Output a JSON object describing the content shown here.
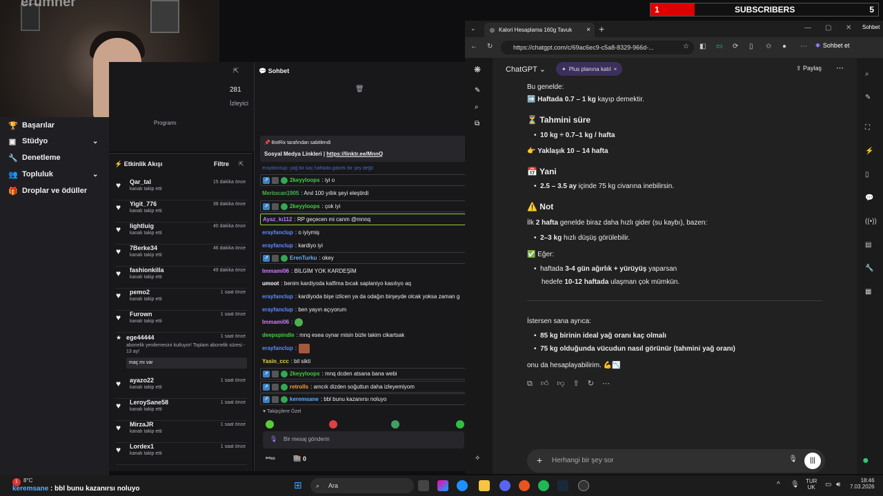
{
  "overlay": {
    "goal_current": "1",
    "label": "SUBSCRIBERS",
    "goal_target": "5",
    "watermark": "erumher"
  },
  "twitch": {
    "stream_viewers": "281",
    "stream_viewers_label": "İzleyici",
    "programs_label": "Programı",
    "nav": [
      {
        "label": "Başarılar",
        "icon": "trophy-icon"
      },
      {
        "label": "Stüdyo",
        "icon": "studio-icon"
      },
      {
        "label": "Denetleme",
        "icon": "wrench-icon"
      },
      {
        "label": "Topluluk",
        "icon": "people-icon"
      },
      {
        "label": "Droplar ve ödüller",
        "icon": "gift-icon"
      }
    ],
    "activity": {
      "title": "Etkinlik Akışı",
      "filter": "Filtre",
      "items": [
        {
          "name": "Qar_tal",
          "sub": "kanalı takip etti",
          "time": "15 dakika önce"
        },
        {
          "name": "Yigit_776",
          "sub": "kanalı takip etti",
          "time": "38 dakika önce"
        },
        {
          "name": "lightluig",
          "sub": "kanalı takip etti",
          "time": "40 dakika önce"
        },
        {
          "name": "7Berke34",
          "sub": "kanalı takip etti",
          "time": "46 dakika önce"
        },
        {
          "name": "fashionkilla",
          "sub": "kanalı takip etti",
          "time": "49 dakika önce"
        },
        {
          "name": "pemo2",
          "sub": "kanalı takip etti",
          "time": "1 saat önce"
        },
        {
          "name": "Furown",
          "sub": "kanalı takip etti",
          "time": "1 saat önce"
        },
        {
          "name": "ayazo22",
          "sub": "kanalı takip etti",
          "time": "1 saat önce"
        },
        {
          "name": "LeroySane58",
          "sub": "kanalı takip etti",
          "time": "1 saat önce"
        },
        {
          "name": "MirzaJR",
          "sub": "kanalı takip etti",
          "time": "1 saat önce"
        },
        {
          "name": "Lordex1",
          "sub": "kanalı takip etti",
          "time": "1 saat önce"
        }
      ],
      "resub": {
        "name": "ege44444",
        "text": "abonelik yenilemesini kutluyor! Toplam abonelik süresi - 13 ay!",
        "message": "maç mı var",
        "time": "1 saat önce"
      }
    },
    "chat": {
      "title": "Sohbet",
      "pinned_by": "BotRix tarafından sabitlendi",
      "pinned_text": "Sosyal Medya Linkleri | ",
      "pinned_link": "https://linktr.ee/MnnQ",
      "partial_line": "erayfanclup: yağ bir kaç haftada gidcek bir şey değil",
      "messages": [
        {
          "user": "2keyyloops",
          "text": ": iyi o",
          "color": "#3fd13f",
          "style": "box"
        },
        {
          "user": "Mertocan1905",
          "text": ": Anıl 100 yıllık şeyi eleştirdi",
          "color": "#4caf50",
          "style": ""
        },
        {
          "user": "2keyyloops",
          "text": ": çok iyi",
          "color": "#3fd13f",
          "style": "box"
        },
        {
          "user": "Ayaz_kı112",
          "text": ": RP geçecen mi canm @mnnq",
          "color": "#b07dff",
          "style": "hl"
        },
        {
          "user": "erayfanclup",
          "text": ": o iyiymiş",
          "color": "#5b8cff",
          "style": ""
        },
        {
          "user": "erayfanclup",
          "text": ": kardiyo iyi",
          "color": "#5b8cff",
          "style": ""
        },
        {
          "user": "ErenTurku",
          "text": ": okey",
          "color": "#5fb0ff",
          "style": "box"
        },
        {
          "user": "Immami06",
          "text": ": BİLGİM YOK KARDEŞİM",
          "color": "#d27cff",
          "style": ""
        },
        {
          "user": "umoot",
          "text": ": benim kardiyoda kalfima bıcak saplaniyo kasılıyo aq",
          "color": "#ffffff",
          "style": ""
        },
        {
          "user": "erayfanclup",
          "text": ": kardiyoda bişe izlicen ya da odağın birşeyde olcak yoksa zaman g",
          "color": "#5b8cff",
          "style": ""
        },
        {
          "user": "erayfanclup",
          "text": ": ben yayın açıyorum",
          "color": "#5b8cff",
          "style": ""
        },
        {
          "user": "Immami06",
          "text": ":",
          "color": "#d27cff",
          "style": ""
        },
        {
          "user": "deepspindle",
          "text": ": mnq esea oynar misin bizle takim cikartsak",
          "color": "#3fd13f",
          "style": ""
        },
        {
          "user": "erayfanclup",
          "text": ":",
          "color": "#5b8cff",
          "style": ""
        },
        {
          "user": "Yasin_ccc",
          "text": ": bil sikti",
          "color": "#e6d34a",
          "style": ""
        },
        {
          "user": "2keyyloops",
          "text": ": mnq dcden atsana bana webi",
          "color": "#3fd13f",
          "style": "box"
        },
        {
          "user": "retrolls",
          "text": ": amcık dizden soğuttun daha izleyemiyom",
          "color": "#ff9b3b",
          "style": "box"
        },
        {
          "user": "keremsane",
          "text": ": bbl bunu kazanırsı noluyo",
          "color": "#5fb0ff",
          "style": "box"
        }
      ],
      "followers_only": "Takipçilere Özel",
      "input_placeholder": "Bir mesaj gönderin",
      "points": "0"
    }
  },
  "browser": {
    "tab_title": "Kalori Hesaplama 160g Tavuk",
    "url": "https://chatgpt.com/c/69ac6ec9-c5a8-8329-966d-...",
    "copilot_label": "Sohbet et",
    "top_right_label": "Sohbet",
    "app_name": "ChatGPT",
    "plus_label": "Plus planına katıl",
    "share_label": "Paylaş",
    "composer_placeholder": "Herhangi bir şey sor",
    "content": {
      "intro": "Bu genelde:",
      "rate_bold": "Haftada 0.7 – 1 kg",
      "rate_rest": " kayıp demektir.",
      "h_time": "⏳ Tahmini süre",
      "calc_bold": "10 kg ÷ 0.7–1 kg / hafta",
      "approx_pre": "👉 ",
      "approx_bold": "Yaklaşık 10 – 14 hafta",
      "h_yani": "📅 Yani",
      "months_bold": "2.5 – 3.5 ay",
      "months_rest": " içinde 75 kg civarına inebilirsin.",
      "h_note": "⚠️ Not",
      "note_pre": "İlk ",
      "note_bold": "2 hafta",
      "note_rest": " genelde biraz daha hızlı gider (su kaybı), bazen:",
      "fast_bold": "2–3 kg",
      "fast_rest": " hızlı düşüş görülebilir.",
      "if_label": "✅ Eğer:",
      "if_pre": "haftada ",
      "if_bold": "3-4 gün ağırlık + yürüyüş",
      "if_rest": " yaparsan",
      "goal_pre": "hedefe ",
      "goal_bold": "10-12 haftada",
      "goal_rest": " ulaşman çok mümkün.",
      "offer": "İstersen sana ayrıca:",
      "opt1": "85 kg birinin ideal yağ oranı kaç olmalı",
      "opt2": "75 kg olduğunda vücudun nasıl görünür (tahmini yağ oranı)",
      "closing": "onu da hesaplayabilirim. 💪📉"
    }
  },
  "taskbar": {
    "temp": "8°C",
    "ticker_user": "keremsane",
    "ticker_text": " : bbl bunu kazanırsı noluyo",
    "search": "Ara",
    "lang1": "TUR",
    "lang2": "UK",
    "time": "18:46",
    "date": "7.03.2026",
    "badge": "1"
  }
}
